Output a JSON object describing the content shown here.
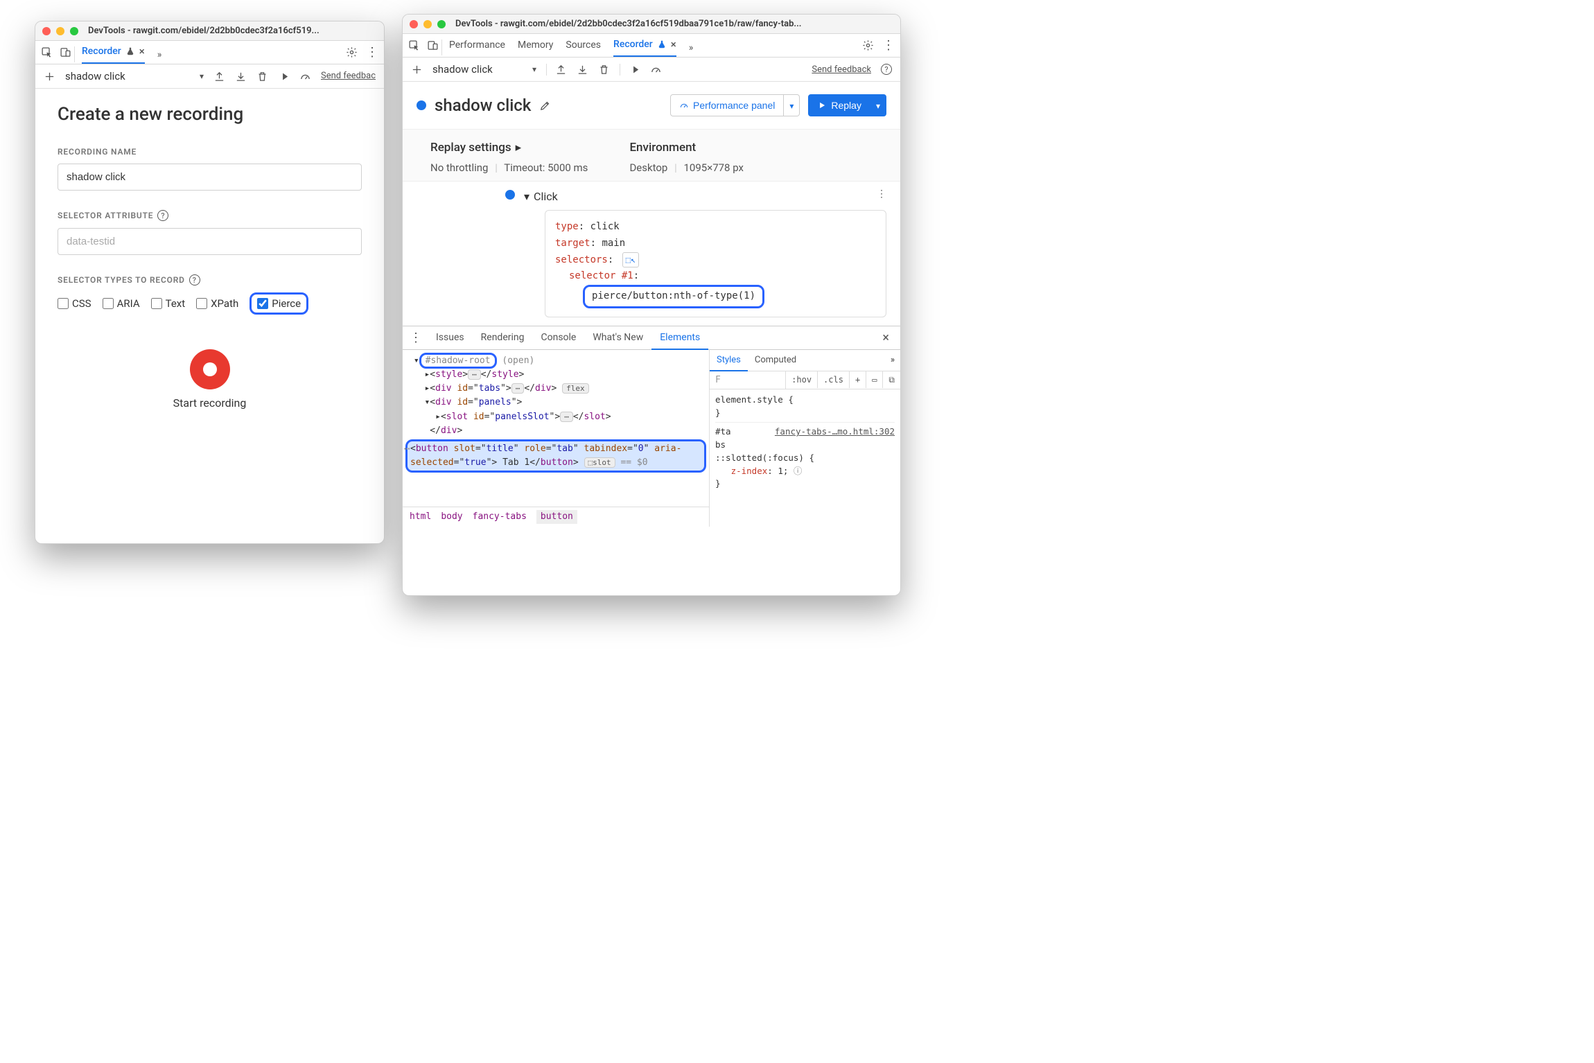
{
  "windowTitleLeft": "DevTools - rawgit.com/ebidel/2d2bb0cdec3f2a16cf519...",
  "windowTitleRight": "DevTools - rawgit.com/ebidel/2d2bb0cdec3f2a16cf519dbaa791ce1b/raw/fancy-tab...",
  "leftTabs": {
    "recorder": "Recorder"
  },
  "rightTabs": {
    "performance": "Performance",
    "memory": "Memory",
    "sources": "Sources",
    "recorder": "Recorder"
  },
  "toolbar": {
    "recordingName": "shadow click",
    "sendFeedback": "Send feedback",
    "sendFeedbackShort": "Send feedbac"
  },
  "create": {
    "title": "Create a new recording",
    "recordingNameLabel": "RECORDING NAME",
    "recordingNameValue": "shadow click",
    "selectorAttrLabel": "SELECTOR ATTRIBUTE",
    "selectorAttrPlaceholder": "data-testid",
    "selectorTypesLabel": "SELECTOR TYPES TO RECORD",
    "types": {
      "css": "CSS",
      "aria": "ARIA",
      "text": "Text",
      "xpath": "XPath",
      "pierce": "Pierce"
    },
    "startBtn": "Start recording"
  },
  "recording": {
    "name": "shadow click",
    "perfPanel": "Performance panel",
    "replay": "Replay",
    "replaySettings": "Replay settings",
    "noThrottling": "No throttling",
    "timeout": "Timeout: 5000 ms",
    "environment": "Environment",
    "desktop": "Desktop",
    "viewport": "1095×778 px",
    "step": {
      "name": "Click",
      "type_k": "type",
      "type_v": "click",
      "target_k": "target",
      "target_v": "main",
      "selectors_k": "selectors",
      "selector1_k": "selector #1",
      "selector1_v": "pierce/button:nth-of-type(1)"
    }
  },
  "drawerTabs": {
    "issues": "Issues",
    "rendering": "Rendering",
    "console": "Console",
    "whatsnew": "What's New",
    "elements": "Elements"
  },
  "dom": {
    "shadowRoot": "#shadow-root",
    "shadowRootMode": "(open)",
    "style": "style",
    "divTabs": "div",
    "divTabsId": "tabs",
    "divPanels": "div",
    "divPanelsId": "panels",
    "slot": "slot",
    "slotId": "panelsSlot",
    "btn": "button",
    "btnSlot": "title",
    "btnRole": "tab",
    "btnTabindex": "0",
    "btnAriaSel": "true",
    "btnText": "Tab 1",
    "flex": "flex",
    "slotBadge": "slot",
    "eqDollar": "== $0"
  },
  "breadcrumb": [
    "html",
    "body",
    "fancy-tabs",
    "button"
  ],
  "styles": {
    "tabs": {
      "styles": "Styles",
      "computed": "Computed"
    },
    "filter": "F",
    "hov": ":hov",
    "cls": ".cls",
    "elementStyle": "element.style {",
    "braceClose": "}",
    "selTa": "#ta",
    "selBs": "bs",
    "link": "fancy-tabs-…mo.html:302",
    "slottedFocus": "::slotted(:focus) {",
    "zIndexK": "z-index",
    "zIndexV": "1"
  }
}
